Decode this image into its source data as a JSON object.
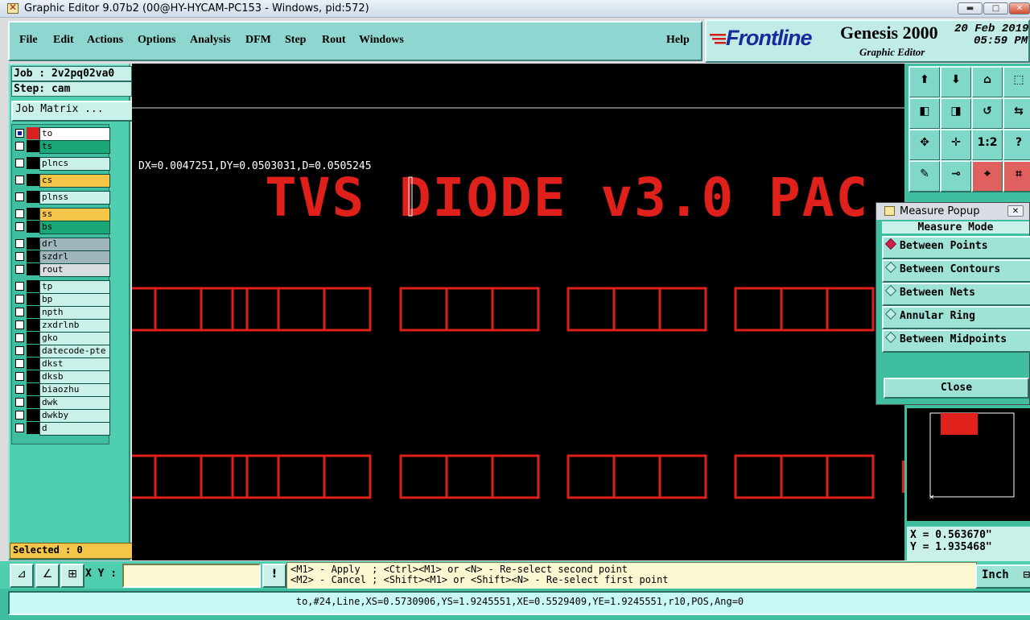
{
  "window": {
    "title": "Graphic Editor 9.07b2 (00@HY-HYCAM-PC153 - Windows, pid:572)",
    "min_glyph": "▬",
    "max_glyph": "□",
    "close_glyph": "✕"
  },
  "menu": {
    "items": [
      "File",
      "Edit",
      "Actions",
      "Options",
      "Analysis",
      "DFM",
      "Step",
      "Rout",
      "Windows"
    ],
    "help": "Help"
  },
  "brand": {
    "logo": "Frontline",
    "product": "Genesis 2000",
    "subtitle": "Graphic Editor",
    "date": "20 Feb 2019",
    "time": "05:59 PM"
  },
  "job": {
    "job_label": "Job : 2v2pq02va0",
    "step_label": "Step: cam",
    "matrix_button": "Job Matrix ..."
  },
  "layers": [
    {
      "name": "to",
      "color": "#ffffff",
      "swatch": "#d82020",
      "active": true
    },
    {
      "name": "ts",
      "color": "#1aa878",
      "swatch": "#000000",
      "active": false
    },
    {
      "name": "plncs",
      "color": "#c9f1ea",
      "swatch": "#000000",
      "active": false
    },
    {
      "name": "cs",
      "color": "#f5c64a",
      "swatch": "#000000",
      "active": false
    },
    {
      "name": "plnss",
      "color": "#c9f1ea",
      "swatch": "#000000",
      "active": false
    },
    {
      "name": "ss",
      "color": "#f5c64a",
      "swatch": "#000000",
      "active": false
    },
    {
      "name": "bs",
      "color": "#1aa878",
      "swatch": "#000000",
      "active": false
    },
    {
      "name": "drl",
      "color": "#9fb6bd",
      "swatch": "#000000",
      "active": false
    },
    {
      "name": "szdrl",
      "color": "#9fb6bd",
      "swatch": "#000000",
      "active": false
    },
    {
      "name": "rout",
      "color": "#d8dde0",
      "swatch": "#000000",
      "active": false
    },
    {
      "name": "tp",
      "color": "#c9f1ea",
      "swatch": "#000000",
      "active": false
    },
    {
      "name": "bp",
      "color": "#c9f1ea",
      "swatch": "#000000",
      "active": false
    },
    {
      "name": "npth",
      "color": "#c9f1ea",
      "swatch": "#000000",
      "active": false
    },
    {
      "name": "zxdrlnb",
      "color": "#c9f1ea",
      "swatch": "#000000",
      "active": false
    },
    {
      "name": "gko",
      "color": "#c9f1ea",
      "swatch": "#000000",
      "active": false
    },
    {
      "name": "datecode-pte",
      "color": "#c9f1ea",
      "swatch": "#000000",
      "active": false
    },
    {
      "name": "dkst",
      "color": "#c9f1ea",
      "swatch": "#000000",
      "active": false
    },
    {
      "name": "dksb",
      "color": "#c9f1ea",
      "swatch": "#000000",
      "active": false
    },
    {
      "name": "biaozhu",
      "color": "#c9f1ea",
      "swatch": "#000000",
      "active": false
    },
    {
      "name": "dwk",
      "color": "#c9f1ea",
      "swatch": "#000000",
      "active": false
    },
    {
      "name": "dwkby",
      "color": "#c9f1ea",
      "swatch": "#000000",
      "active": false
    },
    {
      "name": "d",
      "color": "#c9f1ea",
      "swatch": "#000000",
      "active": false
    }
  ],
  "selected": "Selected : 0",
  "canvas": {
    "measure_readout": "DX=0.0047251,DY=0.0503031,D=0.0505245",
    "silk_text": "TVS DIODE v3.0  PAC"
  },
  "tools": [
    {
      "name": "zoom-home-icon",
      "glyph": "⬆"
    },
    {
      "name": "zoom-down-icon",
      "glyph": "⬇"
    },
    {
      "name": "home-icon",
      "glyph": "⌂"
    },
    {
      "name": "fit-icon",
      "glyph": "⬚"
    },
    {
      "name": "pan-left-icon",
      "glyph": "◧"
    },
    {
      "name": "pan-right-icon",
      "glyph": "◨"
    },
    {
      "name": "undo-view-icon",
      "glyph": "↺"
    },
    {
      "name": "redo-view-icon",
      "glyph": "⇆"
    },
    {
      "name": "zoom-fit-icon",
      "glyph": "✥"
    },
    {
      "name": "zoom-center-icon",
      "glyph": "✛"
    },
    {
      "name": "scale-icon",
      "glyph": "1:2"
    },
    {
      "name": "help-icon",
      "glyph": "?"
    },
    {
      "name": "snap-icon",
      "glyph": "✎"
    },
    {
      "name": "measure-icon",
      "glyph": "⊸"
    },
    {
      "name": "net-icon",
      "glyph": "⌖"
    },
    {
      "name": "net2-icon",
      "glyph": "⌗"
    }
  ],
  "coords": {
    "x": "X = 0.563670\"",
    "y": "Y = 1.935468\""
  },
  "measure_popup": {
    "title": "Measure Popup",
    "header": "Measure Mode",
    "options": [
      "Between Points",
      "Between Contours",
      "Between Nets",
      "Annular Ring",
      "Between Midpoints"
    ],
    "selected_index": 0,
    "close": "Close"
  },
  "bottom": {
    "xy_label": "X Y :",
    "xy_value": "",
    "warn_glyph": "!",
    "hint_line1": "<M1> - Apply  ; <Ctrl><M1> or <N> - Re-select second point",
    "hint_line2": "<M2> - Cancel ; <Shift><M1> or <Shift><N> - Re-select first point",
    "unit": "Inch"
  },
  "status": "to,#24,Line,XS=0.5730906,YS=1.9245551,XE=0.5529409,YE=1.9245551,r10,POS,Ang=0",
  "colors": {
    "accent": "#4fcfb0",
    "feature": "#e0201a"
  }
}
